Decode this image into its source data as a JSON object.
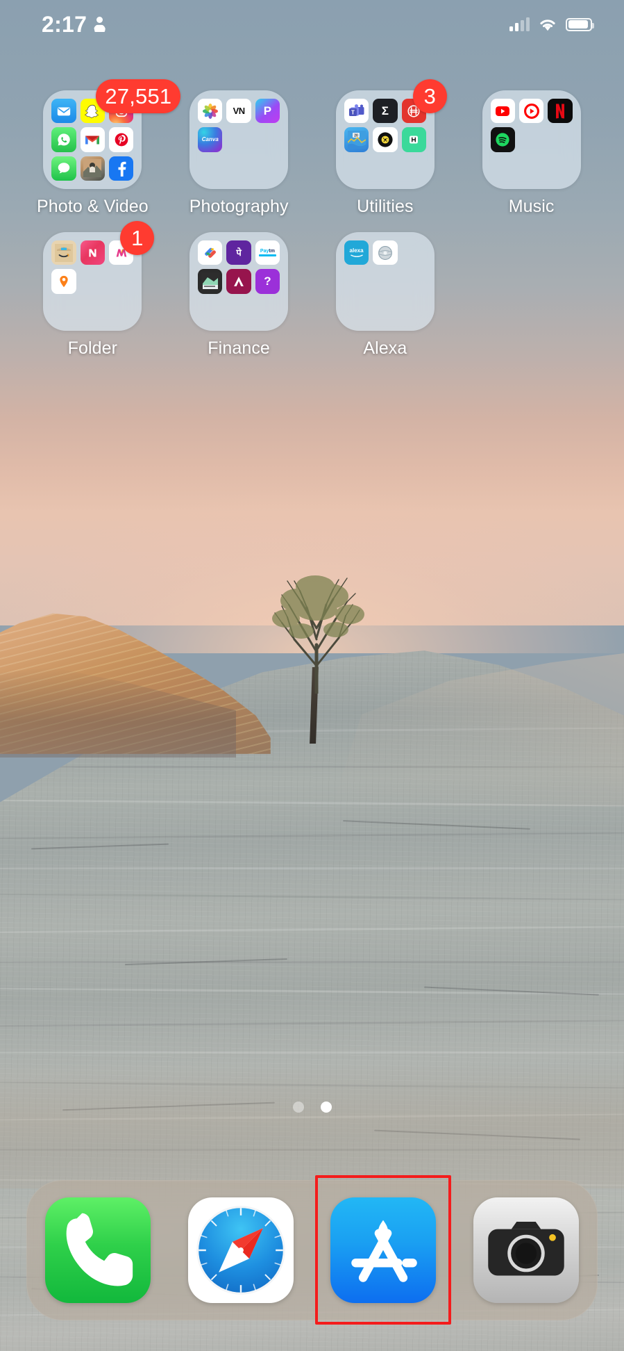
{
  "status_bar": {
    "time": "2:17",
    "person_icon": "person-icon",
    "signal_icon": "cellular-signal-icon",
    "wifi_icon": "wifi-icon",
    "battery_icon": "battery-icon",
    "signal_bars_filled": 2,
    "signal_bars_total": 4,
    "battery_level_percent": 84
  },
  "home_screen": {
    "rows": [
      [
        {
          "label": "Photo & Video",
          "type": "folder",
          "badge": "27,551",
          "badge_wide": true,
          "apps": [
            "Mail",
            "Snapchat",
            "Instagram",
            "WhatsApp",
            "Gmail",
            "Pinterest",
            "Messages",
            "Photo App",
            "Facebook"
          ]
        },
        {
          "label": "Photography",
          "type": "folder",
          "badge": null,
          "apps": [
            "Photos",
            "VN",
            "Picsart",
            "Canva"
          ]
        },
        {
          "label": "Utilities",
          "type": "folder",
          "badge": "3",
          "badge_wide": false,
          "apps": [
            "Microsoft Teams",
            "Sigma Calculator",
            "Hero App",
            "Stocks",
            "Vinyl Player",
            "Hotstar"
          ]
        },
        {
          "label": "Music",
          "type": "folder",
          "badge": null,
          "apps": [
            "YouTube",
            "YouTube Music",
            "Netflix",
            "Spotify"
          ]
        }
      ],
      [
        {
          "label": "Folder",
          "type": "folder",
          "badge": "1",
          "badge_wide": false,
          "apps": [
            "Amazon",
            "Nykaa",
            "Myntra",
            "Swiggy"
          ]
        },
        {
          "label": "Finance",
          "type": "folder",
          "badge": null,
          "apps": [
            "Google Pay",
            "PhonePe",
            "Paytm",
            "Wallet",
            "Axis Bank",
            "Question App"
          ]
        },
        {
          "label": "Alexa",
          "type": "folder",
          "badge": null,
          "apps": [
            "Amazon Alexa",
            "Echo Device"
          ]
        },
        {
          "label": "",
          "type": "empty",
          "badge": null,
          "apps": []
        }
      ]
    ]
  },
  "page_indicator": {
    "total_pages": 2,
    "active_page": 2
  },
  "dock": {
    "items": [
      {
        "label": "Phone",
        "icon": "phone-icon",
        "highlighted": false
      },
      {
        "label": "Safari",
        "icon": "safari-icon",
        "highlighted": false
      },
      {
        "label": "App Store",
        "icon": "app-store-icon",
        "highlighted": true
      },
      {
        "label": "Camera",
        "icon": "camera-icon",
        "highlighted": false
      }
    ]
  },
  "annotation": {
    "highlight_target": "App Store",
    "highlight_color": "#f41c1c"
  },
  "colors": {
    "badge_red": "#ff3b30",
    "folder_bg": "rgba(221,232,241,0.66)",
    "dock_bg": "rgba(186,166,148,0.42)",
    "label_text": "#ffffff"
  }
}
